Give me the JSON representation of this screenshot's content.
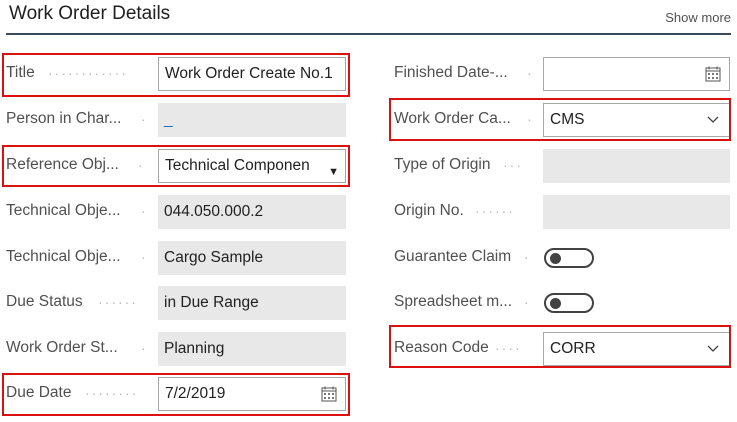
{
  "header": {
    "title": "Work Order Details",
    "show_more": "Show more"
  },
  "left": {
    "title": {
      "label": "Title",
      "value": "Work Order Create No.1"
    },
    "person_in_charge": {
      "label": "Person in Char...",
      "value": "_"
    },
    "reference_object": {
      "label": "Reference Obj...",
      "value": "Technical Componen"
    },
    "technical_object_no": {
      "label": "Technical Obje...",
      "value": "044.050.000.2"
    },
    "technical_object_desc": {
      "label": "Technical Obje...",
      "value": "Cargo Sample"
    },
    "due_status": {
      "label": "Due Status",
      "value": "in Due Range"
    },
    "work_order_status": {
      "label": "Work Order St...",
      "value": "Planning"
    },
    "due_date": {
      "label": "Due Date",
      "value": "7/2/2019"
    }
  },
  "right": {
    "finished_date": {
      "label": "Finished Date-...",
      "value": ""
    },
    "work_order_category": {
      "label": "Work Order Ca...",
      "value": "CMS"
    },
    "type_of_origin": {
      "label": "Type of Origin",
      "value": ""
    },
    "origin_no": {
      "label": "Origin No.",
      "value": ""
    },
    "guarantee_claim": {
      "label": "Guarantee Claim",
      "value": "off"
    },
    "spreadsheet": {
      "label": "Spreadsheet m...",
      "value": "off"
    },
    "reason_code": {
      "label": "Reason Code",
      "value": "CORR"
    }
  },
  "colors": {
    "highlight": "#dd1010",
    "link": "#1a6eb8",
    "readonly_bg": "#e8e8e8"
  },
  "icons": [
    "calendar-icon",
    "chevron-down-icon",
    "dropdown-triangle-icon"
  ]
}
